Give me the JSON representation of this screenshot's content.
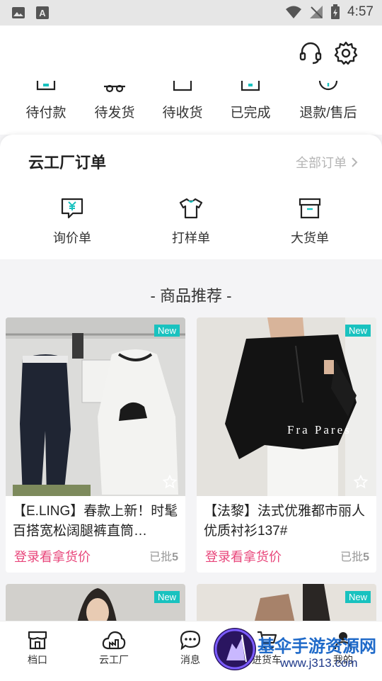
{
  "status_bar": {
    "time": "4:57"
  },
  "order_status": [
    {
      "label": "待付款"
    },
    {
      "label": "待发货"
    },
    {
      "label": "待收货"
    },
    {
      "label": "已完成"
    },
    {
      "label": "退款/售后"
    }
  ],
  "factory": {
    "title": "云工厂订单",
    "all_orders": "全部订单",
    "items": [
      {
        "label": "询价单",
        "icon": "yen-chat-icon"
      },
      {
        "label": "打样单",
        "icon": "tshirt-icon"
      },
      {
        "label": "大货单",
        "icon": "box-icon"
      }
    ]
  },
  "recommend": {
    "title": "- 商品推荐 -",
    "cards": [
      {
        "badge": "New",
        "title": "【E.LING】春款上新！时髦百搭宽松阔腿裤直筒…",
        "price": "登录看拿货价",
        "batch_prefix": "已批",
        "batch_count": "5"
      },
      {
        "badge": "New",
        "title": "【法黎】法式优雅都市丽人优质衬衫137#",
        "price": "登录看拿货价",
        "batch_prefix": "已批",
        "batch_count": "5",
        "image_text": "Fra Pares"
      },
      {
        "badge": "New"
      },
      {
        "badge": "New"
      }
    ]
  },
  "bottom_nav": [
    {
      "label": "档口",
      "icon": "store-icon"
    },
    {
      "label": "云工厂",
      "icon": "cloud-factory-icon"
    },
    {
      "label": "消息",
      "icon": "message-icon"
    },
    {
      "label": "进货车",
      "icon": "cart-icon"
    },
    {
      "label": "我的",
      "icon": "user-icon"
    }
  ],
  "watermark": {
    "line1": "基伞手游资源网",
    "line2": "www.j313.com"
  }
}
